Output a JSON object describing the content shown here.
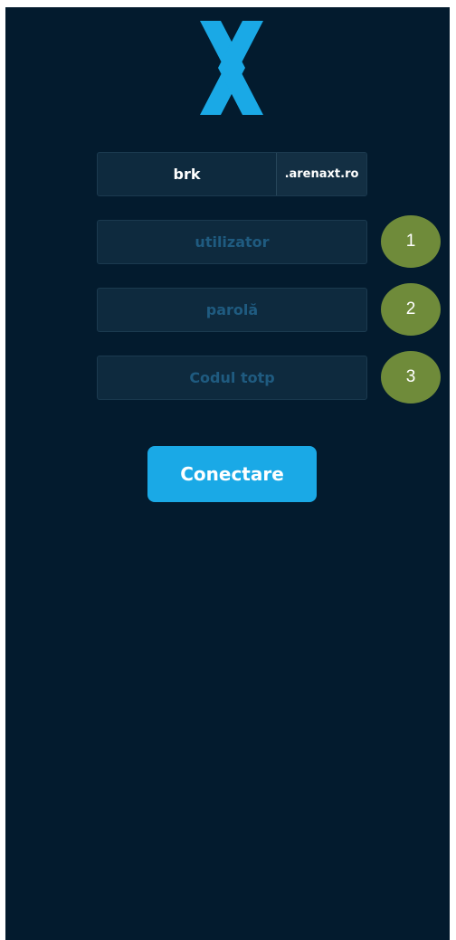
{
  "logo": {
    "icon": "x-logo-icon",
    "color": "#1aa9e6"
  },
  "domain": {
    "subdomain_value": "brk",
    "suffix": ".arenaxt.ro"
  },
  "fields": {
    "username_placeholder": "utilizator",
    "password_placeholder": "parolă",
    "totp_placeholder": "Codul totp"
  },
  "badges": [
    "1",
    "2",
    "3"
  ],
  "login_button": "Conectare",
  "colors": {
    "background": "#031b2e",
    "field_bg": "#0e2a3e",
    "accent": "#1aa9e6",
    "badge": "#6f8b3a",
    "placeholder": "#1f5b80"
  }
}
